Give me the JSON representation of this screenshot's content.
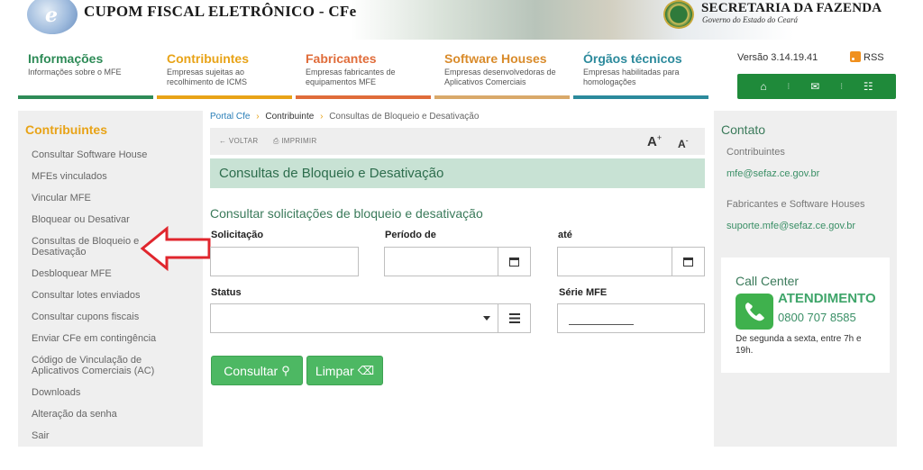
{
  "header": {
    "title": "CUPOM FISCAL ELETRÔNICO - CFe",
    "secretaria": "SECRETARIA DA FAZENDA",
    "governo": "Governo do Estado do Ceará"
  },
  "nav": {
    "items": [
      {
        "title": "Informações",
        "desc": "Informações sobre o MFE",
        "color": "#2e8b57"
      },
      {
        "title": "Contribuintes",
        "desc": "Empresas sujeitas ao recolhimento de ICMS",
        "color": "#e8a317"
      },
      {
        "title": "Fabricantes",
        "desc": "Empresas fabricantes de equipamentos MFE",
        "color": "#e06c3a"
      },
      {
        "title": "Software Houses",
        "desc": "Empresas desenvolvedoras de Aplicativos Comerciais",
        "color": "#d98b2b"
      },
      {
        "title": "Órgãos técnicos",
        "desc": "Empresas habilitadas para homologações",
        "color": "#2c8a9c"
      }
    ],
    "versao": "Versão 3.14.19.41",
    "rss": "RSS",
    "quick_icons": [
      "home-icon",
      "mail-icon",
      "sitemap-icon"
    ]
  },
  "sidebar": {
    "title": "Contribuintes",
    "items": [
      "Consultar Software House",
      "MFEs vinculados",
      "Vincular MFE",
      "Bloquear ou Desativar",
      "Consultas de Bloqueio e Desativação",
      "Desbloquear MFE",
      "Consultar lotes enviados",
      "Consultar cupons fiscais",
      "Enviar CFe em contingência",
      "Código de Vinculação de Aplicativos Comerciais (AC)",
      "Downloads",
      "Alteração da senha",
      "Sair"
    ]
  },
  "breadcrumb": {
    "home": "Portal Cfe",
    "sep": "›",
    "mid": "Contribuinte",
    "current": "Consultas de Bloqueio e Desativação"
  },
  "toolbar": {
    "voltar": "VOLTAR",
    "imprimir": "IMPRIMIR",
    "font_up": "A",
    "font_up_sign": "+",
    "font_down": "A",
    "font_down_sign": "-"
  },
  "page": {
    "title": "Consultas de Bloqueio e Desativação",
    "subtitle": "Consultar solicitações de bloqueio e desativação"
  },
  "form": {
    "solicitacao_label": "Solicitação",
    "periodo_label": "Período de",
    "ate_label": "até",
    "status_label": "Status",
    "serie_label": "Série MFE",
    "solicitacao_value": "",
    "periodo_value": "",
    "ate_value": "",
    "status_value": "",
    "serie_value": ""
  },
  "buttons": {
    "consultar": "Consultar",
    "limpar": "Limpar"
  },
  "contato": {
    "title": "Contato",
    "contribuintes_label": "Contribuintes",
    "contribuintes_email": "mfe@sefaz.ce.gov.br",
    "fab_label": "Fabricantes e Software Houses",
    "fab_email": "suporte.mfe@sefaz.ce.gov.br",
    "call_title": "Call Center",
    "atendimento": "ATENDIMENTO",
    "phone": "0800 707 8585",
    "horario": "De segunda a sexta, entre 7h e 19h."
  },
  "colors": {
    "accent_green": "#1f8a3a",
    "button_green": "#4db863",
    "title_band": "#c8e2d4",
    "sidebar_title": "#e8a317",
    "arrow_red": "#e0262d"
  }
}
